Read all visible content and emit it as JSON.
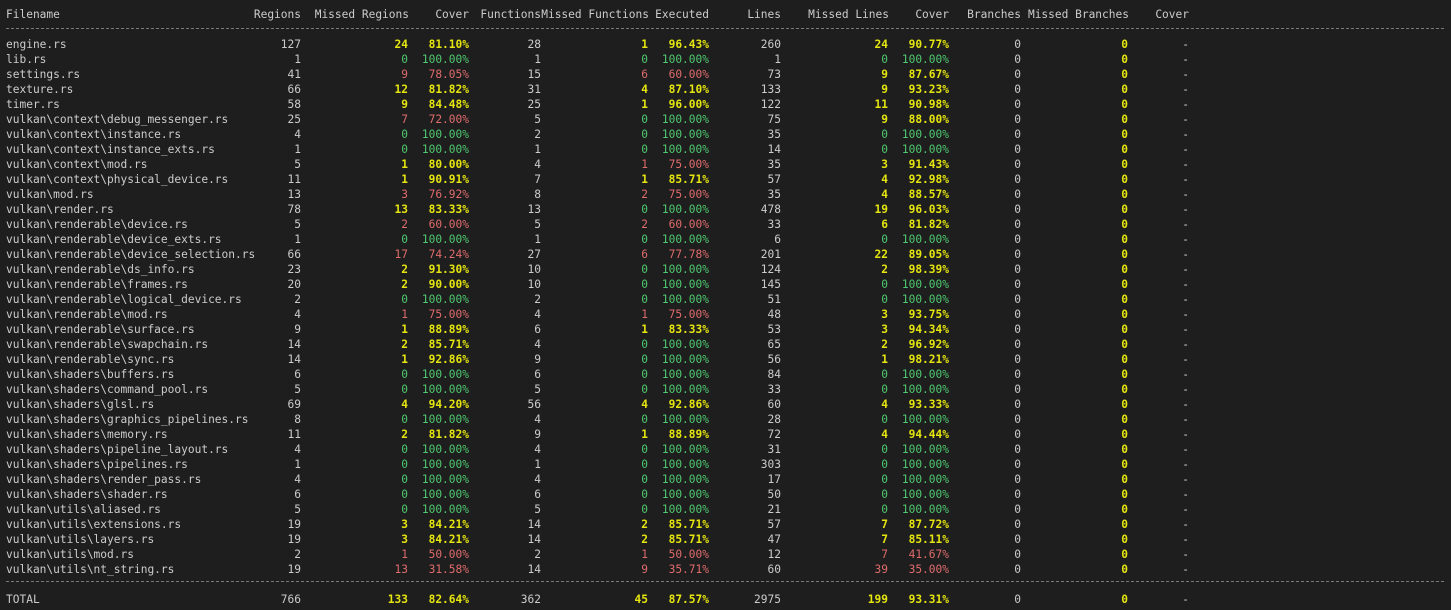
{
  "columns": [
    {
      "key": "file",
      "label": "Filename"
    },
    {
      "key": "regions",
      "label": "Regions"
    },
    {
      "key": "missed_regions",
      "label": "Missed Regions"
    },
    {
      "key": "regions_cover",
      "label": "Cover"
    },
    {
      "key": "functions",
      "label": "Functions"
    },
    {
      "key": "missed_functions",
      "label": "Missed Functions"
    },
    {
      "key": "executed",
      "label": "Executed"
    },
    {
      "key": "lines",
      "label": "Lines"
    },
    {
      "key": "missed_lines",
      "label": "Missed Lines"
    },
    {
      "key": "lines_cover",
      "label": "Cover"
    },
    {
      "key": "branches",
      "label": "Branches"
    },
    {
      "key": "missed_branches",
      "label": "Missed Branches"
    },
    {
      "key": "branches_cover",
      "label": "Cover"
    }
  ],
  "colors": {
    "green": "#4ec96f",
    "yellow": "#e5e510",
    "red": "#e06c6c",
    "background": "#1e1e1e",
    "text": "#cccccc"
  },
  "rows": [
    [
      "engine.rs",
      "127",
      "24",
      "81.10%",
      "28",
      "1",
      "96.43%",
      "260",
      "24",
      "90.77%",
      "0",
      "0",
      "-"
    ],
    [
      "lib.rs",
      "1",
      "0",
      "100.00%",
      "1",
      "0",
      "100.00%",
      "1",
      "0",
      "100.00%",
      "0",
      "0",
      "-"
    ],
    [
      "settings.rs",
      "41",
      "9",
      "78.05%",
      "15",
      "6",
      "60.00%",
      "73",
      "9",
      "87.67%",
      "0",
      "0",
      "-"
    ],
    [
      "texture.rs",
      "66",
      "12",
      "81.82%",
      "31",
      "4",
      "87.10%",
      "133",
      "9",
      "93.23%",
      "0",
      "0",
      "-"
    ],
    [
      "timer.rs",
      "58",
      "9",
      "84.48%",
      "25",
      "1",
      "96.00%",
      "122",
      "11",
      "90.98%",
      "0",
      "0",
      "-"
    ],
    [
      "vulkan\\context\\debug_messenger.rs",
      "25",
      "7",
      "72.00%",
      "5",
      "0",
      "100.00%",
      "75",
      "9",
      "88.00%",
      "0",
      "0",
      "-"
    ],
    [
      "vulkan\\context\\instance.rs",
      "4",
      "0",
      "100.00%",
      "2",
      "0",
      "100.00%",
      "35",
      "0",
      "100.00%",
      "0",
      "0",
      "-"
    ],
    [
      "vulkan\\context\\instance_exts.rs",
      "1",
      "0",
      "100.00%",
      "1",
      "0",
      "100.00%",
      "14",
      "0",
      "100.00%",
      "0",
      "0",
      "-"
    ],
    [
      "vulkan\\context\\mod.rs",
      "5",
      "1",
      "80.00%",
      "4",
      "1",
      "75.00%",
      "35",
      "3",
      "91.43%",
      "0",
      "0",
      "-"
    ],
    [
      "vulkan\\context\\physical_device.rs",
      "11",
      "1",
      "90.91%",
      "7",
      "1",
      "85.71%",
      "57",
      "4",
      "92.98%",
      "0",
      "0",
      "-"
    ],
    [
      "vulkan\\mod.rs",
      "13",
      "3",
      "76.92%",
      "8",
      "2",
      "75.00%",
      "35",
      "4",
      "88.57%",
      "0",
      "0",
      "-"
    ],
    [
      "vulkan\\render.rs",
      "78",
      "13",
      "83.33%",
      "13",
      "0",
      "100.00%",
      "478",
      "19",
      "96.03%",
      "0",
      "0",
      "-"
    ],
    [
      "vulkan\\renderable\\device.rs",
      "5",
      "2",
      "60.00%",
      "5",
      "2",
      "60.00%",
      "33",
      "6",
      "81.82%",
      "0",
      "0",
      "-"
    ],
    [
      "vulkan\\renderable\\device_exts.rs",
      "1",
      "0",
      "100.00%",
      "1",
      "0",
      "100.00%",
      "6",
      "0",
      "100.00%",
      "0",
      "0",
      "-"
    ],
    [
      "vulkan\\renderable\\device_selection.rs",
      "66",
      "17",
      "74.24%",
      "27",
      "6",
      "77.78%",
      "201",
      "22",
      "89.05%",
      "0",
      "0",
      "-"
    ],
    [
      "vulkan\\renderable\\ds_info.rs",
      "23",
      "2",
      "91.30%",
      "10",
      "0",
      "100.00%",
      "124",
      "2",
      "98.39%",
      "0",
      "0",
      "-"
    ],
    [
      "vulkan\\renderable\\frames.rs",
      "20",
      "2",
      "90.00%",
      "10",
      "0",
      "100.00%",
      "145",
      "0",
      "100.00%",
      "0",
      "0",
      "-"
    ],
    [
      "vulkan\\renderable\\logical_device.rs",
      "2",
      "0",
      "100.00%",
      "2",
      "0",
      "100.00%",
      "51",
      "0",
      "100.00%",
      "0",
      "0",
      "-"
    ],
    [
      "vulkan\\renderable\\mod.rs",
      "4",
      "1",
      "75.00%",
      "4",
      "1",
      "75.00%",
      "48",
      "3",
      "93.75%",
      "0",
      "0",
      "-"
    ],
    [
      "vulkan\\renderable\\surface.rs",
      "9",
      "1",
      "88.89%",
      "6",
      "1",
      "83.33%",
      "53",
      "3",
      "94.34%",
      "0",
      "0",
      "-"
    ],
    [
      "vulkan\\renderable\\swapchain.rs",
      "14",
      "2",
      "85.71%",
      "4",
      "0",
      "100.00%",
      "65",
      "2",
      "96.92%",
      "0",
      "0",
      "-"
    ],
    [
      "vulkan\\renderable\\sync.rs",
      "14",
      "1",
      "92.86%",
      "9",
      "0",
      "100.00%",
      "56",
      "1",
      "98.21%",
      "0",
      "0",
      "-"
    ],
    [
      "vulkan\\shaders\\buffers.rs",
      "6",
      "0",
      "100.00%",
      "6",
      "0",
      "100.00%",
      "84",
      "0",
      "100.00%",
      "0",
      "0",
      "-"
    ],
    [
      "vulkan\\shaders\\command_pool.rs",
      "5",
      "0",
      "100.00%",
      "5",
      "0",
      "100.00%",
      "33",
      "0",
      "100.00%",
      "0",
      "0",
      "-"
    ],
    [
      "vulkan\\shaders\\glsl.rs",
      "69",
      "4",
      "94.20%",
      "56",
      "4",
      "92.86%",
      "60",
      "4",
      "93.33%",
      "0",
      "0",
      "-"
    ],
    [
      "vulkan\\shaders\\graphics_pipelines.rs",
      "8",
      "0",
      "100.00%",
      "4",
      "0",
      "100.00%",
      "28",
      "0",
      "100.00%",
      "0",
      "0",
      "-"
    ],
    [
      "vulkan\\shaders\\memory.rs",
      "11",
      "2",
      "81.82%",
      "9",
      "1",
      "88.89%",
      "72",
      "4",
      "94.44%",
      "0",
      "0",
      "-"
    ],
    [
      "vulkan\\shaders\\pipeline_layout.rs",
      "4",
      "0",
      "100.00%",
      "4",
      "0",
      "100.00%",
      "31",
      "0",
      "100.00%",
      "0",
      "0",
      "-"
    ],
    [
      "vulkan\\shaders\\pipelines.rs",
      "1",
      "0",
      "100.00%",
      "1",
      "0",
      "100.00%",
      "303",
      "0",
      "100.00%",
      "0",
      "0",
      "-"
    ],
    [
      "vulkan\\shaders\\render_pass.rs",
      "4",
      "0",
      "100.00%",
      "4",
      "0",
      "100.00%",
      "17",
      "0",
      "100.00%",
      "0",
      "0",
      "-"
    ],
    [
      "vulkan\\shaders\\shader.rs",
      "6",
      "0",
      "100.00%",
      "6",
      "0",
      "100.00%",
      "50",
      "0",
      "100.00%",
      "0",
      "0",
      "-"
    ],
    [
      "vulkan\\utils\\aliased.rs",
      "5",
      "0",
      "100.00%",
      "5",
      "0",
      "100.00%",
      "21",
      "0",
      "100.00%",
      "0",
      "0",
      "-"
    ],
    [
      "vulkan\\utils\\extensions.rs",
      "19",
      "3",
      "84.21%",
      "14",
      "2",
      "85.71%",
      "57",
      "7",
      "87.72%",
      "0",
      "0",
      "-"
    ],
    [
      "vulkan\\utils\\layers.rs",
      "19",
      "3",
      "84.21%",
      "14",
      "2",
      "85.71%",
      "47",
      "7",
      "85.11%",
      "0",
      "0",
      "-"
    ],
    [
      "vulkan\\utils\\mod.rs",
      "2",
      "1",
      "50.00%",
      "2",
      "1",
      "50.00%",
      "12",
      "7",
      "41.67%",
      "0",
      "0",
      "-"
    ],
    [
      "vulkan\\utils\\nt_string.rs",
      "19",
      "13",
      "31.58%",
      "14",
      "9",
      "35.71%",
      "60",
      "39",
      "35.00%",
      "0",
      "0",
      "-"
    ]
  ],
  "total": [
    "TOTAL",
    "766",
    "133",
    "82.64%",
    "362",
    "45",
    "87.57%",
    "2975",
    "199",
    "93.31%",
    "0",
    "0",
    "-"
  ]
}
